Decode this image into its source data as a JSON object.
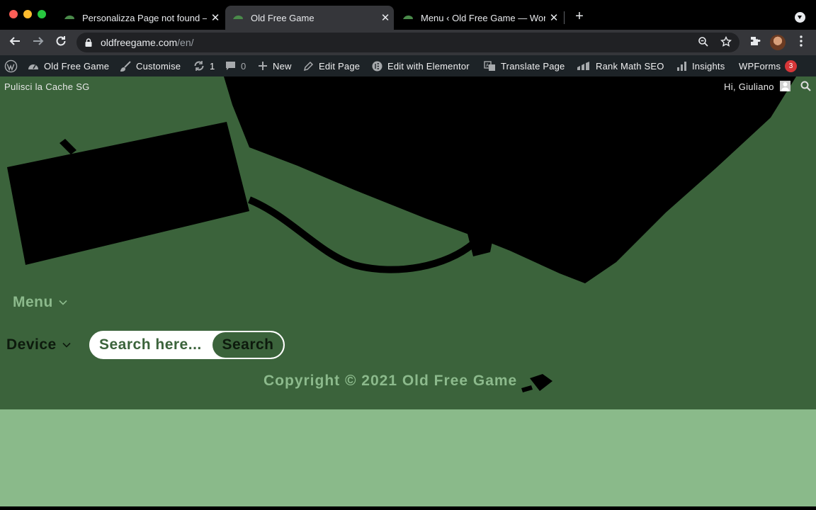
{
  "browser": {
    "tabs": [
      {
        "title": "Personalizza Page not found –",
        "active": false
      },
      {
        "title": "Old Free Game",
        "active": true
      },
      {
        "title": "Menu ‹ Old Free Game — Word",
        "active": false
      }
    ],
    "close_glyph": "✕",
    "new_tab_glyph": "+",
    "url_host": "oldfreegame.com",
    "url_path": "/en/",
    "icons": [
      "back-icon",
      "forward-icon",
      "reload-icon",
      "lock-icon",
      "zoom-icon",
      "star-icon",
      "extensions-icon",
      "menu-kebab-icon"
    ]
  },
  "adminbar": {
    "site_name": "Old Free Game",
    "customise": "Customise",
    "updates_count": "1",
    "comments_count": "0",
    "new_label": "New",
    "edit_page": "Edit Page",
    "edit_elementor": "Edit with Elementor",
    "translate_page": "Translate Page",
    "rank_math": "Rank Math SEO",
    "insights": "Insights",
    "wpforms": "WPForms",
    "wpforms_badge": "3"
  },
  "page": {
    "cache_link": "Pulisci la Cache SG",
    "greeting": "Hi, Giuliano",
    "menu_label": "Menu",
    "device_label": "Device",
    "search_placeholder": "Search here...",
    "search_button": "Search",
    "copyright": "Copyright © 2021 Old Free Game"
  },
  "colors": {
    "page_bg": "#3b633b",
    "accent_light": "#8cba8c",
    "footer_band": "#8aba8a",
    "adminbar_bg": "#1d2327",
    "badge": "#d63638"
  }
}
